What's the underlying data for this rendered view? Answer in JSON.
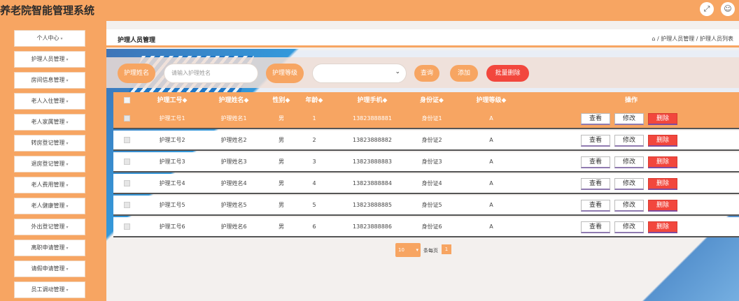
{
  "app": {
    "title": "养老院智能管理系统"
  },
  "header_icons": [
    "fullscreen-icon",
    "user-icon"
  ],
  "sidebar": {
    "items": [
      {
        "label": "个人中心"
      },
      {
        "label": "护理人员管理"
      },
      {
        "label": "房间信息管理"
      },
      {
        "label": "老人入住管理"
      },
      {
        "label": "老人家属管理"
      },
      {
        "label": "转房登记管理"
      },
      {
        "label": "退房登记管理"
      },
      {
        "label": "老人费用管理"
      },
      {
        "label": "老人健康管理"
      },
      {
        "label": "外出登记管理"
      },
      {
        "label": "离职申请管理"
      },
      {
        "label": "请假申请管理"
      },
      {
        "label": "员工调动管理"
      }
    ]
  },
  "page": {
    "title": "护理人员管理",
    "breadcrumb": "/ 护理人员管理 / 护理人员列表"
  },
  "search": {
    "name_label": "护理姓名",
    "name_placeholder": "请输入护理姓名",
    "level_label": "护理等级",
    "level_value": "",
    "query_button": "查询",
    "add_button": "添加",
    "batch_delete_button": "批量删除"
  },
  "table": {
    "columns": [
      "护理工号◆",
      "护理姓名◆",
      "性别◆",
      "年龄◆",
      "护理手机◆",
      "身份证◆",
      "护理等级◆",
      "操作"
    ],
    "rows": [
      {
        "id": "护理工号1",
        "name": "护理姓名1",
        "gender": "男",
        "age": "1",
        "phone": "13823888881",
        "idcard": "身份证1",
        "level": "A"
      },
      {
        "id": "护理工号2",
        "name": "护理姓名2",
        "gender": "男",
        "age": "2",
        "phone": "13823888882",
        "idcard": "身份证2",
        "level": "A"
      },
      {
        "id": "护理工号3",
        "name": "护理姓名3",
        "gender": "男",
        "age": "3",
        "phone": "13823888883",
        "idcard": "身份证3",
        "level": "A"
      },
      {
        "id": "护理工号4",
        "name": "护理姓名4",
        "gender": "男",
        "age": "4",
        "phone": "13823888884",
        "idcard": "身份证4",
        "level": "A"
      },
      {
        "id": "护理工号5",
        "name": "护理姓名5",
        "gender": "男",
        "age": "5",
        "phone": "13823888885",
        "idcard": "身份证5",
        "level": "A"
      },
      {
        "id": "护理工号6",
        "name": "护理姓名6",
        "gender": "男",
        "age": "6",
        "phone": "13823888886",
        "idcard": "身份证6",
        "level": "A"
      }
    ],
    "actions": {
      "view": "查看",
      "edit": "修改",
      "delete": "删除"
    }
  },
  "pager": {
    "page_size": "10",
    "per_page_label": "条每页",
    "current_page": "1"
  },
  "colors": {
    "accent": "#f7a562",
    "danger": "#f2473d"
  }
}
